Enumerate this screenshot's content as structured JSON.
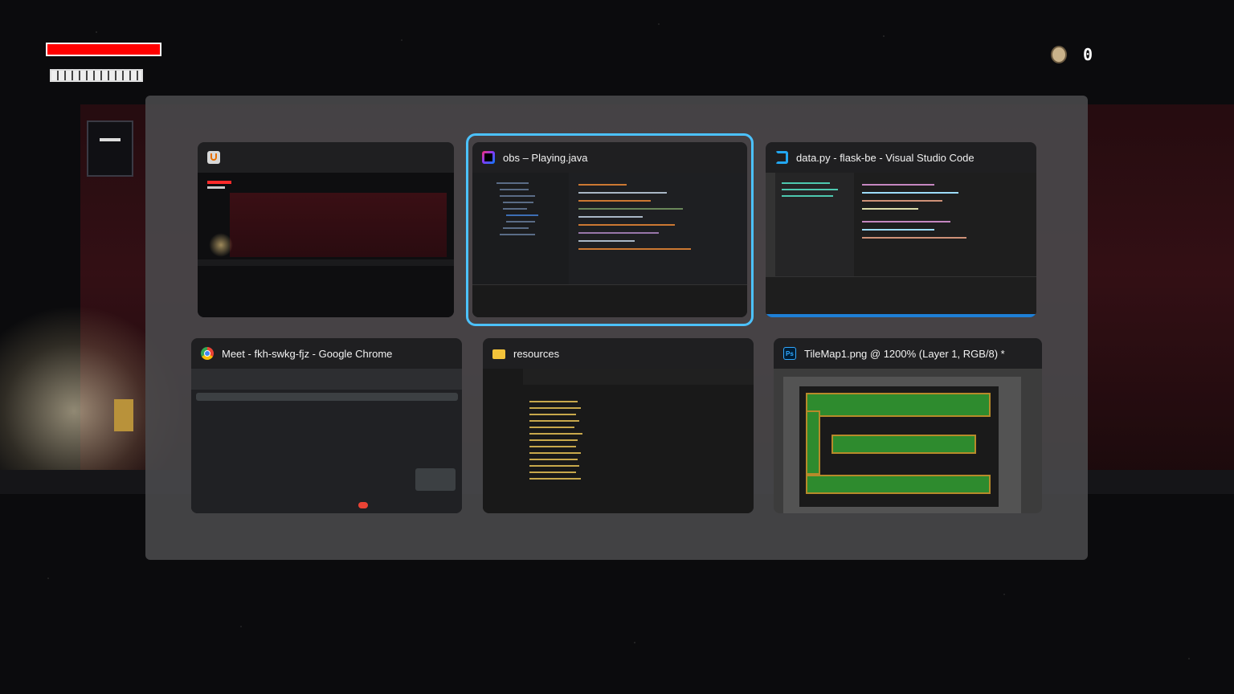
{
  "game": {
    "coin_count": "0",
    "hp_fraction": 1.0
  },
  "task_view": {
    "windows": [
      {
        "title": "",
        "app": "java",
        "selected": false
      },
      {
        "title": "obs – Playing.java",
        "app": "intellij-idea",
        "selected": true
      },
      {
        "title": "data.py - flask-be - Visual Studio Code",
        "app": "vscode",
        "selected": false
      },
      {
        "title": "Meet - fkh-swkg-fjz - Google Chrome",
        "app": "chrome",
        "selected": false
      },
      {
        "title": "resources",
        "app": "file-explorer",
        "selected": false
      },
      {
        "title": "TileMap1.png @ 1200% (Layer 1, RGB/8) *",
        "app": "photoshop",
        "selected": false
      }
    ],
    "colors": {
      "selection_ring": "#4cc2ff",
      "panel": "#4a4a4c",
      "card": "#1f1f21"
    }
  }
}
